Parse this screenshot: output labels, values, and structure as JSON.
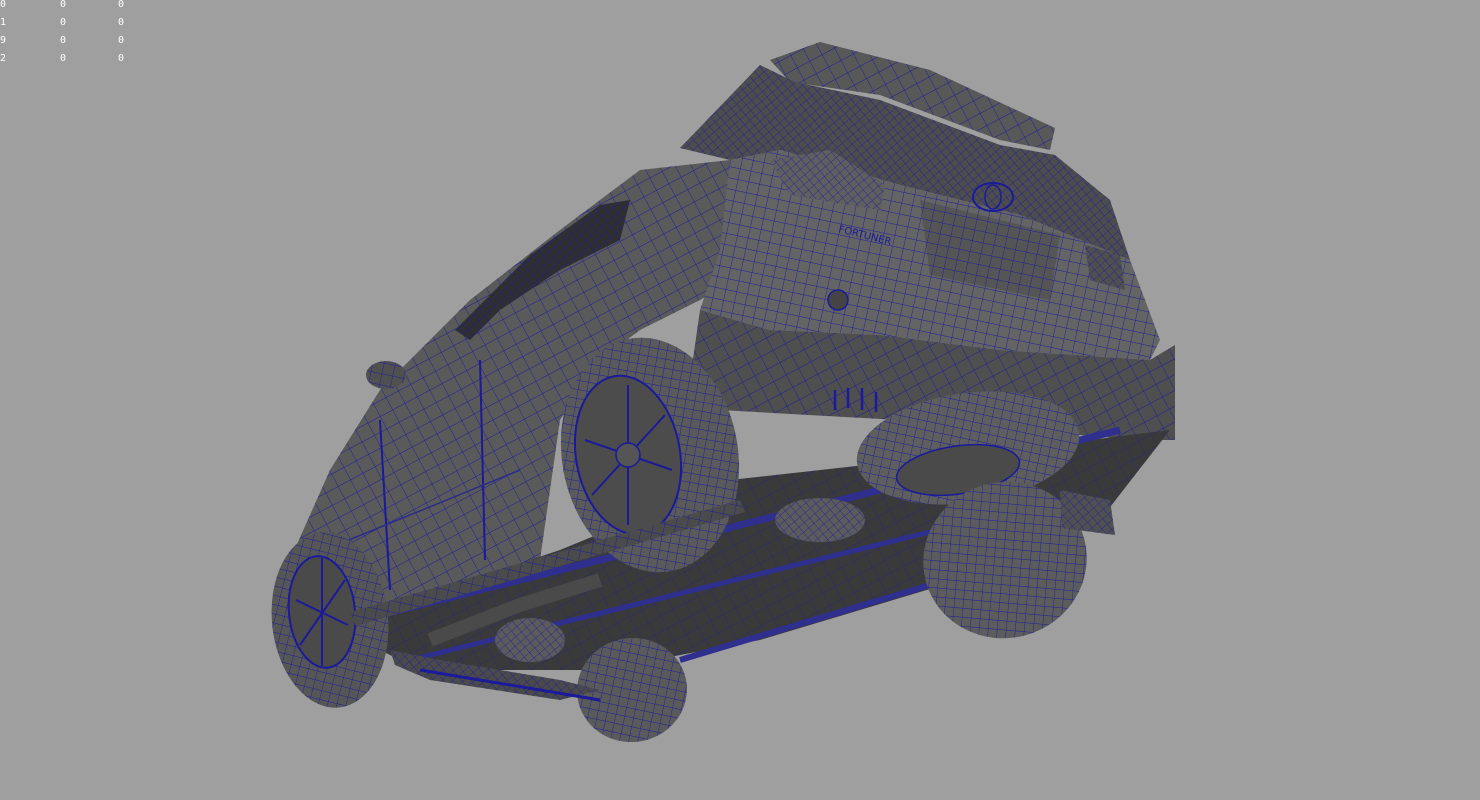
{
  "hud": {
    "rows": [
      [
        "0",
        "0",
        "0"
      ],
      [
        "1",
        "0",
        "0"
      ],
      [
        "9",
        "0",
        "0"
      ],
      [
        "2",
        "0",
        "0"
      ]
    ]
  },
  "model": {
    "badge_text": "FORTUNER",
    "body_color": "#5c5c5c",
    "shadow_color": "#3a3a3a",
    "dark_color": "#2b2b2b",
    "wire_color": "#1a1a9a",
    "background": "#9f9f9f"
  }
}
